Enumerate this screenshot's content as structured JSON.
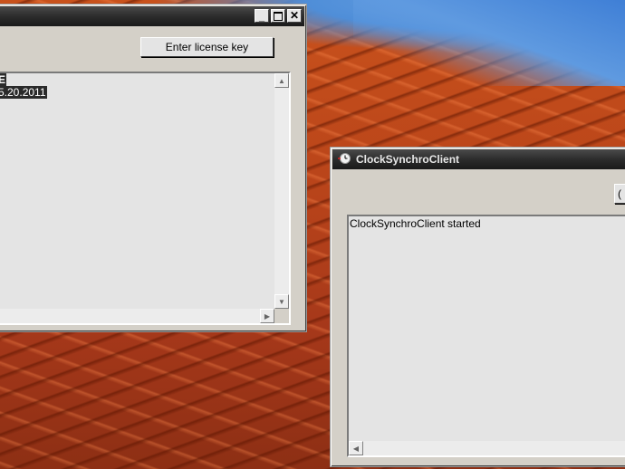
{
  "desktop": {
    "wallpaper": "red-sand-dunes"
  },
  "window1": {
    "title": "",
    "enter_license_label": "Enter license key",
    "log_lines": [
      "E",
      "5.20.2011"
    ],
    "caption": {
      "minimize": "_",
      "maximize": "□",
      "close": "✕"
    }
  },
  "window2": {
    "title": "ClockSynchroClient",
    "partial_button_label": "(",
    "log_lines": [
      "ClockSynchroClient started"
    ],
    "icon": "clock-icon"
  },
  "colors": {
    "titlebar": "#2c2c2c",
    "window_face": "#d4d0c8",
    "textarea_bg": "#e4e4e4",
    "selection": "#2a2a2a"
  }
}
